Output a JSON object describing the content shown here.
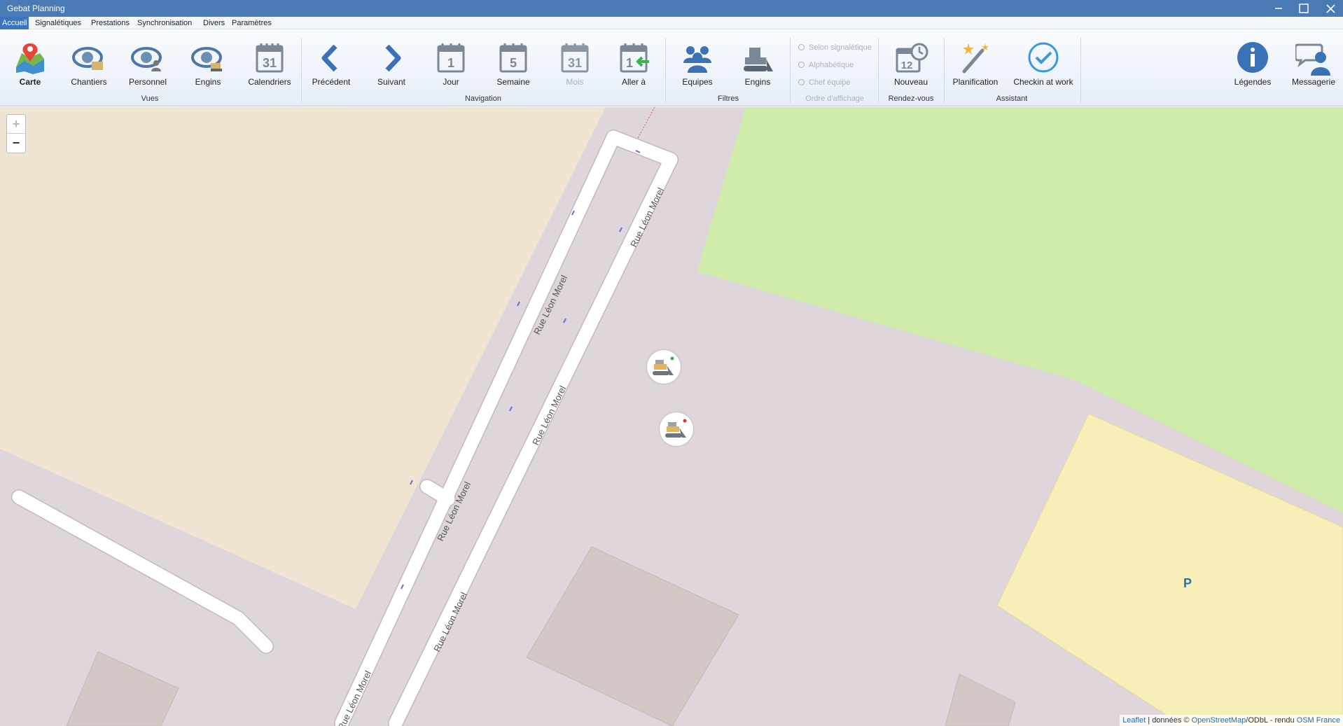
{
  "window": {
    "title": "Gebat Planning"
  },
  "menu": {
    "items": [
      {
        "label": "Accueil",
        "active": true
      },
      {
        "label": "Signalétiques"
      },
      {
        "label": "Prestations"
      },
      {
        "label": "Synchronisation"
      },
      {
        "label": "Divers"
      },
      {
        "label": "Paramètres"
      }
    ]
  },
  "ribbon": {
    "vues": {
      "group_label": "Vues",
      "carte": "Carte",
      "chantiers": "Chantiers",
      "personnel": "Personnel",
      "engins": "Engins",
      "calendriers": "Calendriers"
    },
    "navigation": {
      "group_label": "Navigation",
      "precedent": "Précédent",
      "suivant": "Suivant",
      "jour": "Jour",
      "semaine": "Semaine",
      "mois": "Mois",
      "aller": "Aller à",
      "jour_num": "1",
      "semaine_num": "5",
      "mois_num": "31"
    },
    "filtres": {
      "group_label": "Filtres",
      "equipes": "Equipes",
      "engins": "Engins"
    },
    "ordre": {
      "group_label": "Ordre d'affichage",
      "options": [
        "Selon signalétique",
        "Alphabétique",
        "Chef équipe"
      ]
    },
    "rdv": {
      "group_label": "Rendez-vous",
      "nouveau": "Nouveau"
    },
    "assistant": {
      "group_label": "Assistant",
      "planification": "Planification",
      "checkin": "Checkin at work"
    },
    "legendes": "Légendes",
    "messagerie": "Messagerie"
  },
  "map": {
    "zoom_in": "+",
    "zoom_out": "−",
    "streets": [
      "Rue Léon Morel",
      "Rue Léon Morel",
      "Rue Léon Morel",
      "Rue Léon Morel",
      "Rue Léon Morel",
      "Rue Léon Morel"
    ],
    "parking": "P",
    "markers": [
      {
        "icon": "excavator-icon",
        "status_color": "#3bb54a"
      },
      {
        "icon": "excavator-icon",
        "status_color": "#d83a2a"
      }
    ],
    "attribution": {
      "leaflet": "Leaflet",
      "sep": " | données © ",
      "osm": "OpenStreetMap",
      "odbl": "/ODbL - rendu ",
      "osmfr": "OSM France"
    }
  },
  "colors": {
    "titlebar": "#4a7ab4",
    "accent": "#3b75c2",
    "map_bg": "#ded6db",
    "residential": "#f2e4d2",
    "grass": "#cfecaa",
    "parking": "#f7efb7"
  }
}
